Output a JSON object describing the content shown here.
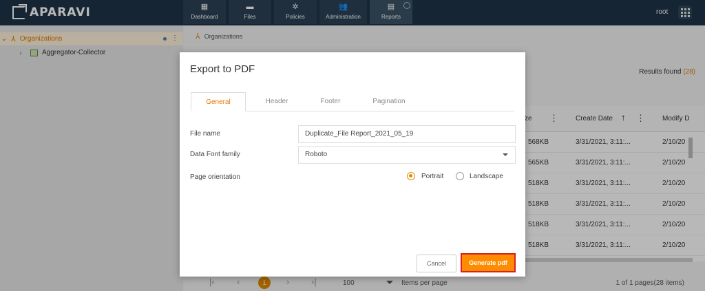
{
  "app": {
    "brand": "APARAVI",
    "user": "root"
  },
  "nav": [
    {
      "label": "Dashboard",
      "icon": "dashboard-icon"
    },
    {
      "label": "Files",
      "icon": "folder-icon"
    },
    {
      "label": "Policies",
      "icon": "gear-icon"
    },
    {
      "label": "Administration",
      "icon": "users-icon"
    },
    {
      "label": "Reports",
      "icon": "clipboard-icon"
    }
  ],
  "sidebar": {
    "items": [
      {
        "label": "Organizations"
      },
      {
        "label": "Aggregator-Collector"
      }
    ]
  },
  "breadcrumb": {
    "label": "Organizations"
  },
  "results": {
    "label": "Results found",
    "count": "(28)"
  },
  "table": {
    "columns": [
      "ze",
      "Create Date",
      "Modify D"
    ],
    "rows": [
      [
        "568KB",
        "3/31/2021, 3:11:...",
        "2/10/20"
      ],
      [
        "565KB",
        "3/31/2021, 3:11:...",
        "2/10/20"
      ],
      [
        "518KB",
        "3/31/2021, 3:11:...",
        "2/10/20"
      ],
      [
        "518KB",
        "3/31/2021, 3:11:...",
        "2/10/20"
      ],
      [
        "518KB",
        "3/31/2021, 3:11:...",
        "2/10/20"
      ],
      [
        "518KB",
        "3/31/2021, 3:11:...",
        "2/10/20"
      ]
    ]
  },
  "pager": {
    "current": "1",
    "page_size": "100",
    "page_size_label": "Items per page",
    "info": "1 of 1 pages(28 items)"
  },
  "modal": {
    "title": "Export to PDF",
    "tabs": [
      "General",
      "Header",
      "Footer",
      "Pagination"
    ],
    "file_name_label": "File name",
    "file_name_value": "Duplicate_File Report_2021_05_19",
    "font_label": "Data Font family",
    "font_value": "Roboto",
    "orientation_label": "Page orientation",
    "portrait_label": "Portrait",
    "landscape_label": "Landscape",
    "cancel_label": "Cancel",
    "generate_label": "Generate pdf"
  },
  "colors": {
    "accent": "#ff8c00",
    "topbar": "#1f3447",
    "highlight": "#d91f1f"
  }
}
